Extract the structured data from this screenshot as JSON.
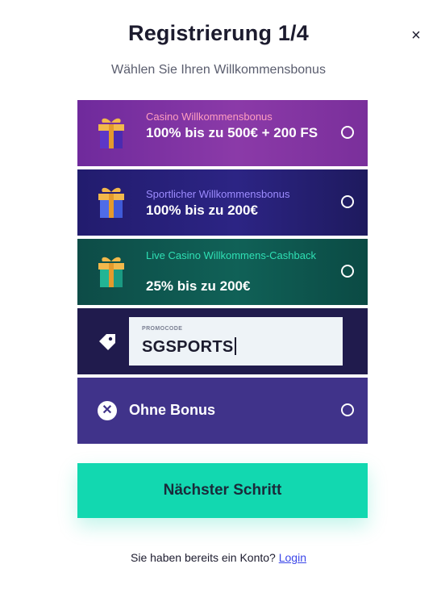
{
  "header": {
    "title": "Registrierung 1/4",
    "close_symbol": "×",
    "subtitle": "Wählen Sie Ihren Willkommensbonus"
  },
  "bonuses": [
    {
      "subtitle": "Casino Willkommensbonus",
      "title": "100% bis zu 500€ + 200 FS",
      "icon": "gift-icon",
      "background": "#8b3aa8",
      "subtitle_color": "#ff9ec0"
    },
    {
      "subtitle": "Sportlicher Willkommensbonus",
      "title": "100% bis zu 200€",
      "icon": "gift-icon",
      "background": "#2c2484",
      "subtitle_color": "#9d8cff"
    },
    {
      "subtitle": "Live Casino Willkommens-Cashback",
      "title": "25% bis zu 200€",
      "icon": "gift-icon",
      "background": "#106157",
      "subtitle_color": "#2fe0b4"
    }
  ],
  "promo": {
    "label": "PROMOCODE",
    "value": "SGSPORTS",
    "icon": "tag-icon"
  },
  "no_bonus": {
    "label": "Ohne Bonus",
    "icon": "close-circle-icon"
  },
  "next_button": {
    "label": "Nächster Schritt",
    "color": "#12d8b0"
  },
  "footer": {
    "text": "Sie haben bereits ein Konto?",
    "link": "Login"
  }
}
